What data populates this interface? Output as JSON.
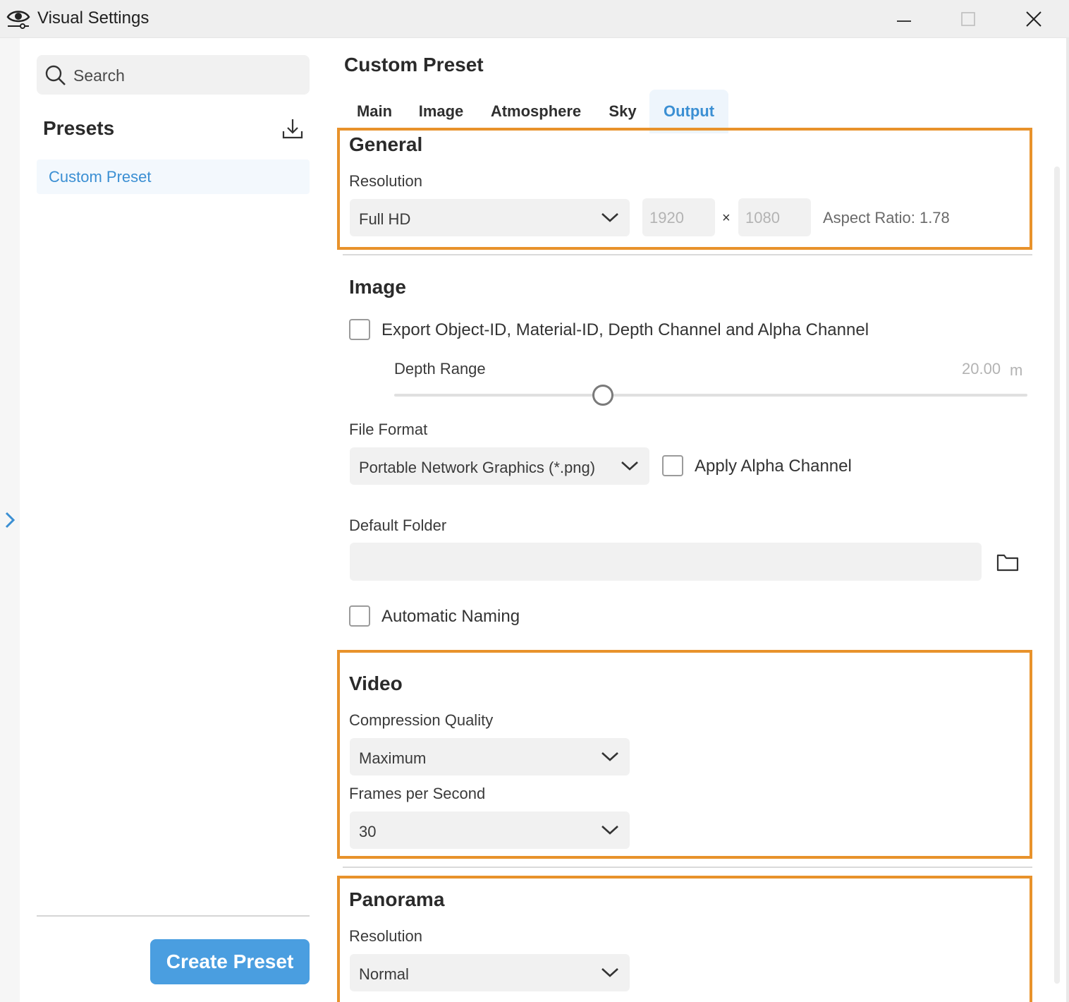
{
  "window": {
    "title": "Visual Settings",
    "icons": {
      "app": "eye-icon",
      "minimize": "minimize-icon",
      "maximize": "maximize-icon",
      "close": "close-icon"
    }
  },
  "sidebar": {
    "search_placeholder": "Search",
    "presets_title": "Presets",
    "items": [
      {
        "label": "Custom Preset",
        "selected": true
      }
    ],
    "create_button": "Create Preset"
  },
  "main": {
    "title": "Custom Preset",
    "tabs": [
      {
        "label": "Main"
      },
      {
        "label": "Image"
      },
      {
        "label": "Atmosphere"
      },
      {
        "label": "Sky"
      },
      {
        "label": "Output",
        "active": true
      }
    ],
    "general": {
      "title": "General",
      "resolution_label": "Resolution",
      "resolution_value": "Full HD",
      "width": "1920",
      "times": "×",
      "height": "1080",
      "aspect_ratio": "Aspect Ratio: 1.78"
    },
    "image": {
      "title": "Image",
      "export_label": "Export Object-ID, Material-ID, Depth Channel and Alpha Channel",
      "export_checked": false,
      "depth_range_label": "Depth Range",
      "depth_value": "20.00",
      "depth_unit": "m",
      "depth_slider_fraction": 0.33,
      "file_format_label": "File Format",
      "file_format_value": "Portable Network Graphics (*.png)",
      "apply_alpha_label": "Apply Alpha Channel",
      "apply_alpha_checked": false,
      "default_folder_label": "Default Folder",
      "default_folder_value": "",
      "automatic_naming_label": "Automatic Naming",
      "automatic_naming_checked": false
    },
    "video": {
      "title": "Video",
      "compression_label": "Compression Quality",
      "compression_value": "Maximum",
      "fps_label": "Frames per Second",
      "fps_value": "30"
    },
    "panorama": {
      "title": "Panorama",
      "resolution_label": "Resolution",
      "resolution_value": "Normal"
    }
  },
  "colors": {
    "accent": "#3b8fd3",
    "button": "#4a9ee0",
    "highlight": "#e8922b"
  }
}
